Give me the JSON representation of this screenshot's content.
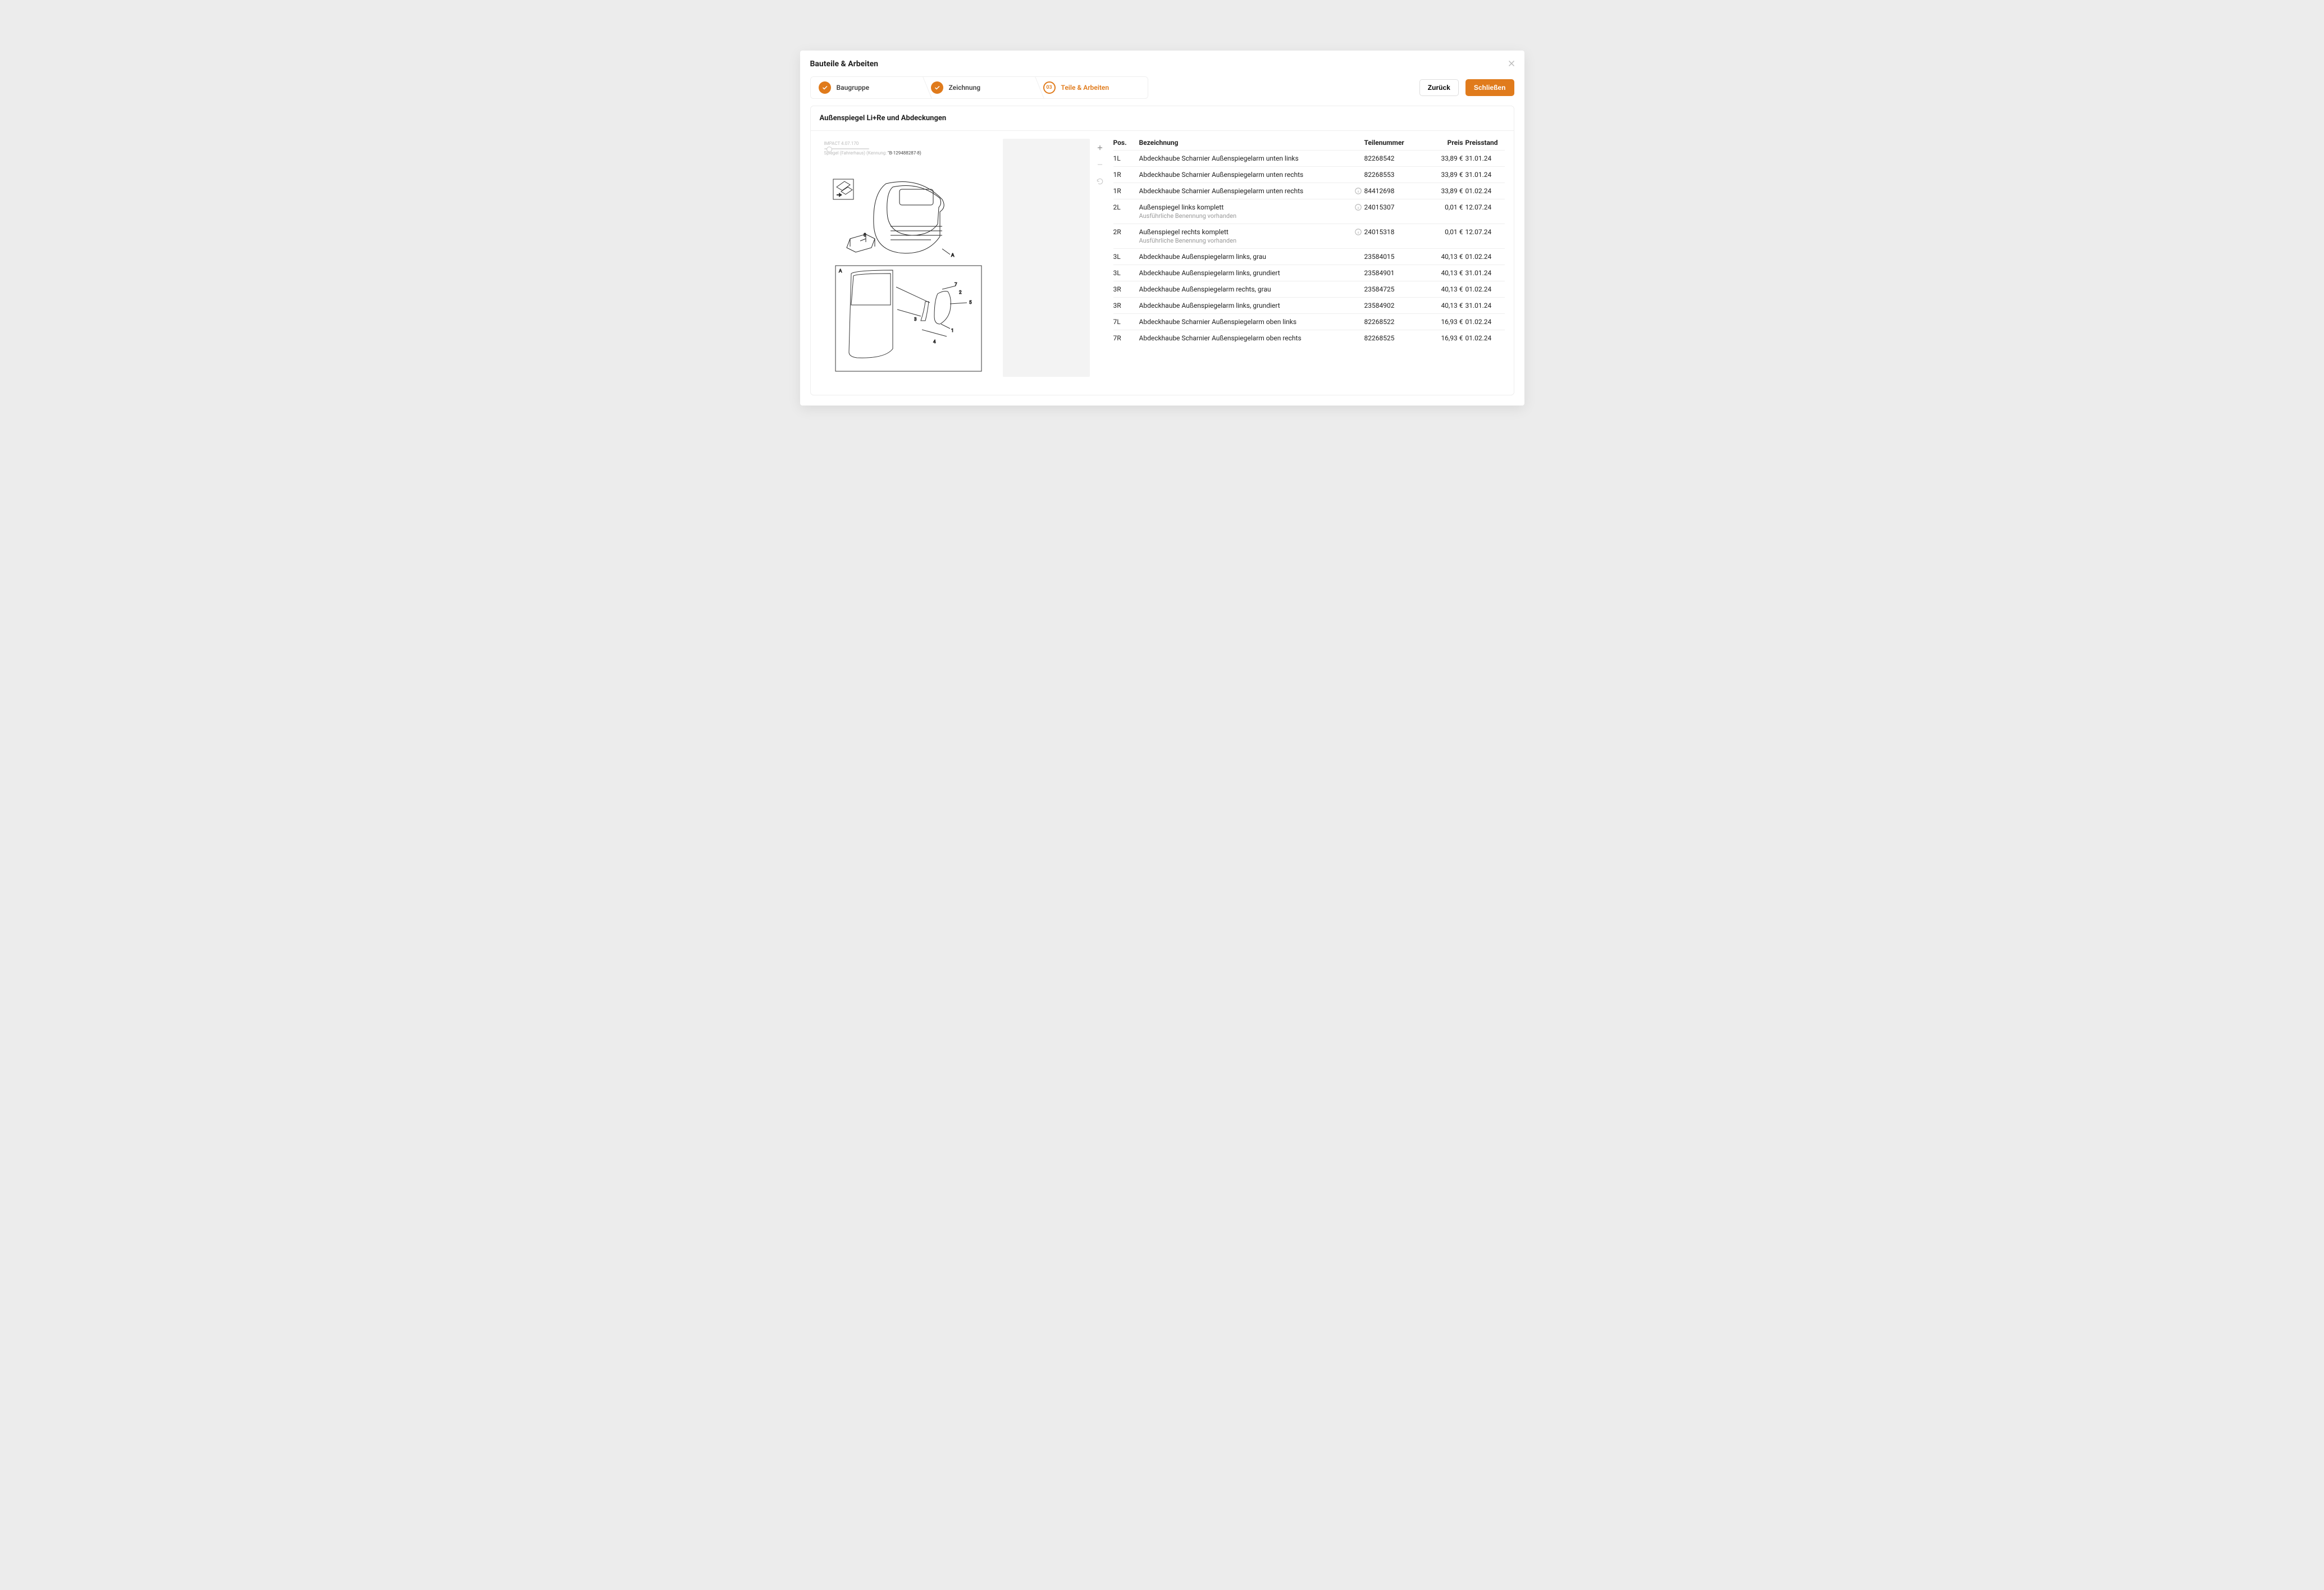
{
  "modal": {
    "title": "Bauteile & Arbeiten",
    "close_aria": "Schließen"
  },
  "stepper": {
    "step1": {
      "label": "Baugruppe"
    },
    "step2": {
      "label": "Zeichnung"
    },
    "step3": {
      "num": "03",
      "label": "Teile & Arbeiten"
    }
  },
  "actions": {
    "back": "Zurück",
    "close": "Schließen"
  },
  "card": {
    "title": "Außenspiegel Li+Re und Abdeckungen"
  },
  "drawing_meta": {
    "line1": "IMPACT 4.07.170",
    "part_label": "Spiegel (Fahrerhaus)",
    "kennung_label": "(Kennung:",
    "kennung_value": "\"B-129488287-8)"
  },
  "zoom": {
    "in_aria": "Vergrößern",
    "out_aria": "Verkleinern",
    "reset_aria": "Zurücksetzen"
  },
  "table": {
    "columns": {
      "pos": "Pos.",
      "description": "Bezeichnung",
      "partno": "Teilenummer",
      "price": "Preis",
      "pricedate": "Preisstand"
    },
    "rows": [
      {
        "pos": "1L",
        "desc": "Abdeckhaube Scharnier Außenspiegelarm unten links",
        "sub": "",
        "info": false,
        "pn": "82268542",
        "price": "33,89 €",
        "date": "31.01.24"
      },
      {
        "pos": "1R",
        "desc": "Abdeckhaube Scharnier Außenspiegelarm unten rechts",
        "sub": "",
        "info": false,
        "pn": "82268553",
        "price": "33,89 €",
        "date": "31.01.24"
      },
      {
        "pos": "1R",
        "desc": "Abdeckhaube Scharnier Außenspiegelarm unten rechts",
        "sub": "",
        "info": true,
        "pn": "84412698",
        "price": "33,89 €",
        "date": "01.02.24"
      },
      {
        "pos": "2L",
        "desc": "Außenspiegel links komplett",
        "sub": "Ausführliche Benennung vorhanden",
        "info": true,
        "pn": "24015307",
        "price": "0,01 €",
        "date": "12.07.24"
      },
      {
        "pos": "2R",
        "desc": "Außenspiegel rechts komplett",
        "sub": "Ausführliche Benennung vorhanden",
        "info": true,
        "pn": "24015318",
        "price": "0,01 €",
        "date": "12.07.24"
      },
      {
        "pos": "3L",
        "desc": "Abdeckhaube Außenspiegelarm links, grau",
        "sub": "",
        "info": false,
        "pn": "23584015",
        "price": "40,13 €",
        "date": "01.02.24"
      },
      {
        "pos": "3L",
        "desc": "Abdeckhaube Außenspiegelarm links, grundiert",
        "sub": "",
        "info": false,
        "pn": "23584901",
        "price": "40,13 €",
        "date": "31.01.24"
      },
      {
        "pos": "3R",
        "desc": "Abdeckhaube Außenspiegelarm rechts, grau",
        "sub": "",
        "info": false,
        "pn": "23584725",
        "price": "40,13 €",
        "date": "01.02.24"
      },
      {
        "pos": "3R",
        "desc": "Abdeckhaube Außenspiegelarm links, grundiert",
        "sub": "",
        "info": false,
        "pn": "23584902",
        "price": "40,13 €",
        "date": "31.01.24"
      },
      {
        "pos": "7L",
        "desc": "Abdeckhaube Scharnier Außenspiegelarm oben links",
        "sub": "",
        "info": false,
        "pn": "82268522",
        "price": "16,93 €",
        "date": "01.02.24"
      },
      {
        "pos": "7R",
        "desc": "Abdeckhaube Scharnier Außenspiegelarm oben rechts",
        "sub": "",
        "info": false,
        "pn": "82268525",
        "price": "16,93 €",
        "date": "01.02.24"
      }
    ]
  }
}
